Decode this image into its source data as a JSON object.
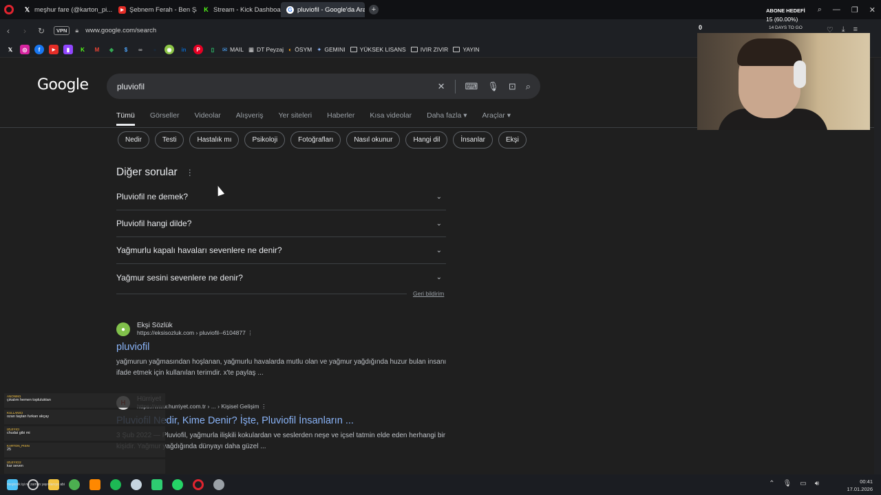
{
  "browser": {
    "tabs": [
      {
        "label": "meşhur fare (@karton_pi...",
        "icon": "x-icon",
        "active": false
      },
      {
        "label": "Şebnem Ferah - Ben Şarkı...",
        "icon": "youtube-icon",
        "active": false
      },
      {
        "label": "Stream - Kick Dashboard",
        "icon": "kick-icon",
        "active": false
      },
      {
        "label": "pluviofil - Google'da Ara",
        "icon": "google-icon",
        "active": true
      }
    ],
    "vpn_label": "VPN",
    "url": "www.google.com/search",
    "bookmarks": [
      {
        "label": "MAIL"
      },
      {
        "label": "DT Peyzaj"
      },
      {
        "label": "ÖSYM"
      },
      {
        "label": "GEMINI"
      },
      {
        "label": "YÜKSEK LISANS"
      },
      {
        "label": "IVIR ZIVIR"
      },
      {
        "label": "YAYIN"
      }
    ]
  },
  "google": {
    "logo": "Google",
    "query": "pluviofil",
    "tabs": [
      "Tümü",
      "Görseller",
      "Videolar",
      "Alışveriş",
      "Yer siteleri",
      "Haberler",
      "Kısa videolar",
      "Daha fazla",
      "Araçlar"
    ],
    "chips": [
      "Nedir",
      "Testi",
      "Hastalık mı",
      "Psikoloji",
      "Fotoğrafları",
      "Nasıl okunur",
      "Hangi dil",
      "İnsanlar",
      "Ekşi"
    ],
    "paa_title": "Diğer sorular",
    "paa": [
      "Pluviofil ne demek?",
      "Pluviofil hangi dilde?",
      "Yağmurlu kapalı havaları sevenlere ne denir?",
      "Yağmur sesini sevenlere ne denir?"
    ],
    "feedback": "Geri bildirim",
    "results": [
      {
        "site": "Ekşi Sözlük",
        "url": "https://eksisozluk.com › pluviofil--6104877",
        "title": "pluviofil",
        "snippet": "yağmurun yağmasından hoşlanan, yağmurlu havalarda mutlu olan ve yağmur yağdığında huzur bulan insanı ifade etmek için kullanılan terimdir. x'te paylaş ..."
      },
      {
        "site": "Hürriyet",
        "url": "https://www.hurriyet.com.tr › ... › Kişisel Gelişim",
        "title": "Pluviofil Nedir, Kime Denir? İşte, Pluviofil İnsanların ...",
        "snippet": "3 Şub 2022 — Pluviofil, yağmurla ilişkili kokulardan ve seslerden neşe ve içsel tatmin elde eden herhangi bir kişidir. Yağmur yağdığında dünyayı daha güzel ..."
      }
    ]
  },
  "stream_overlay": {
    "title": "ABONE HEDEFİ",
    "count": "15 (60.00%)",
    "days": "14 DAYS TO GO",
    "zero": "0"
  },
  "chat": [
    {
      "user": "ANONIM1",
      "text": "çıkalım hemen topluluktan"
    },
    {
      "user": "KULLANICI",
      "text": "ozan taştan furkan akçay"
    },
    {
      "user": "IZLEYICI",
      "text": "chudai gibi mi"
    },
    {
      "user": "KARTON_PISIN",
      "text": "25"
    },
    {
      "user": "IZLEYICI2",
      "text": "kar seven"
    },
    {
      "user": "IZLEYICI3",
      "text": "meşkotik işi ne zaman yayınlanıyo abi"
    }
  ],
  "taskbar": {
    "time": "00:41",
    "date": "17.01.2026"
  },
  "colors": {
    "background": "#1f1f1f",
    "link": "#8ab4f8",
    "opera_red": "#e0242f"
  }
}
